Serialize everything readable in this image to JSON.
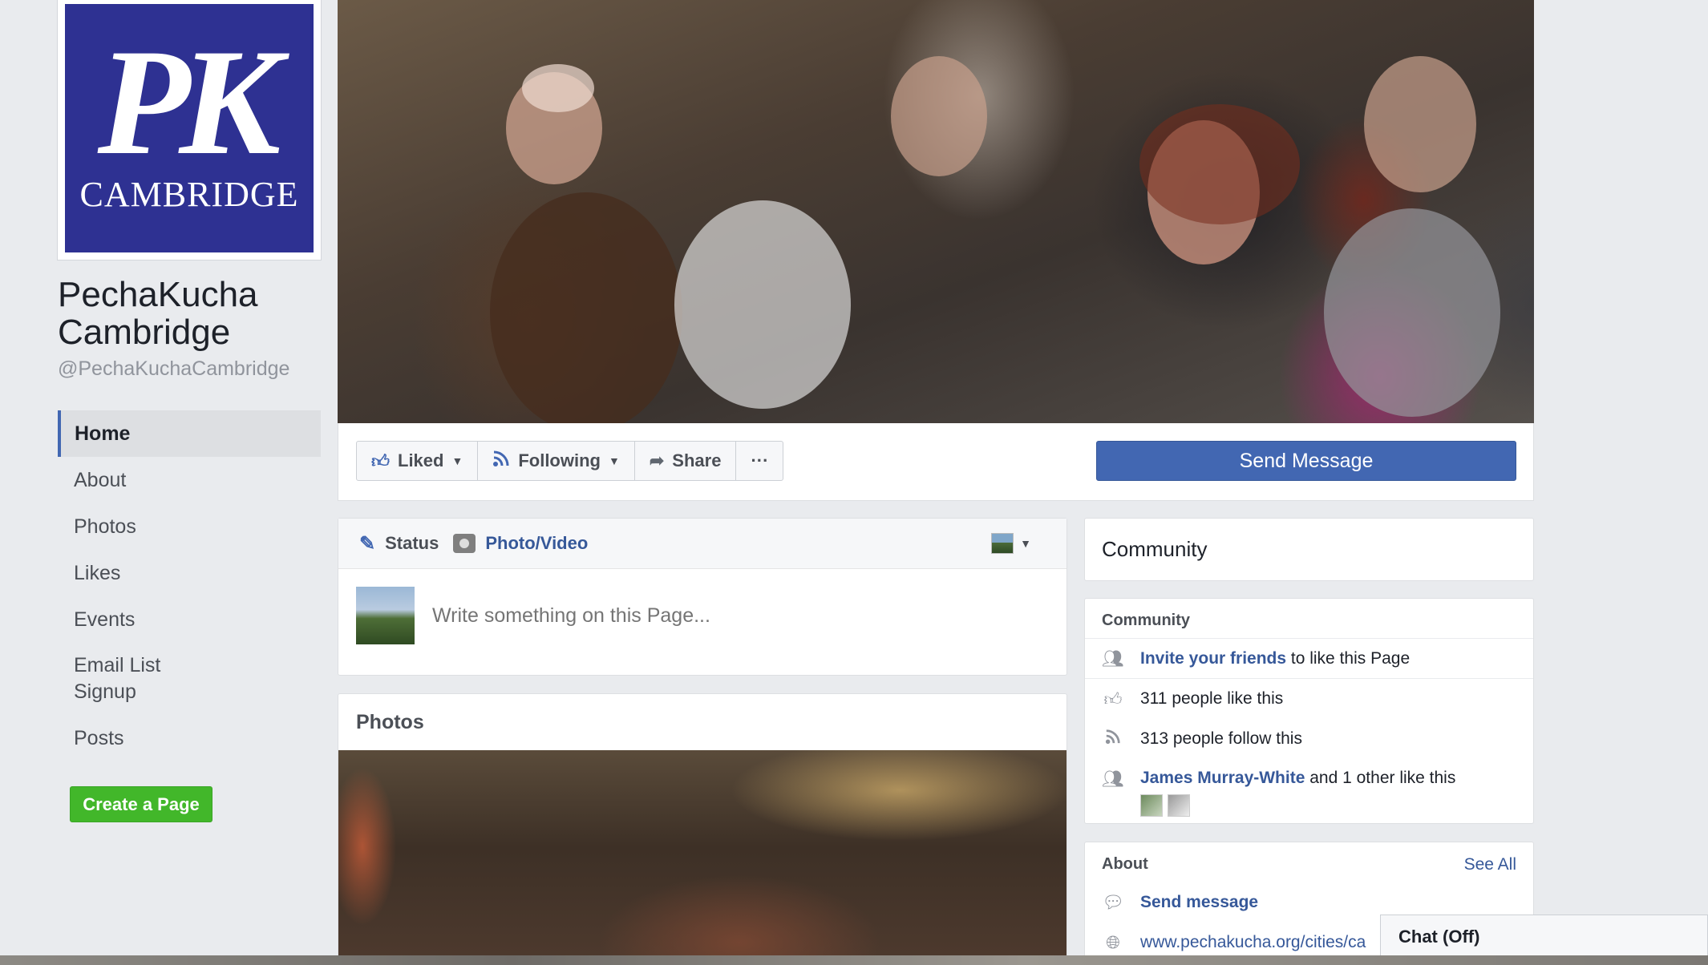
{
  "page": {
    "logo": {
      "monogram": "PK",
      "city": "CAMBRIDGE",
      "bg_color": "#2e3192"
    },
    "name": "PechaKucha Cambridge",
    "handle": "@PechaKuchaCambridge"
  },
  "nav": {
    "items": [
      {
        "label": "Home",
        "active": true
      },
      {
        "label": "About"
      },
      {
        "label": "Photos"
      },
      {
        "label": "Likes"
      },
      {
        "label": "Events"
      },
      {
        "label": "Email List Signup"
      },
      {
        "label": "Posts"
      }
    ],
    "create_page": "Create a Page"
  },
  "actions": {
    "liked": "Liked",
    "following": "Following",
    "share": "Share",
    "more": "···",
    "send_message": "Send Message"
  },
  "composer": {
    "tab_status": "Status",
    "tab_photo": "Photo/Video",
    "placeholder": "Write something on this Page..."
  },
  "photos": {
    "title": "Photos"
  },
  "community": {
    "header": "Community",
    "sub_title": "Community",
    "invite_link": "Invite your friends",
    "invite_rest": " to like this Page",
    "likes": "311 people like this",
    "follows": "313 people follow this",
    "friend_link": "James Murray-White",
    "friend_rest": " and 1 other like this"
  },
  "about": {
    "title": "About",
    "see_all": "See All",
    "send_message": "Send message",
    "website": "www.pechakucha.org/cities/ca"
  },
  "chat": {
    "label": "Chat (Off)"
  },
  "colors": {
    "accent": "#4267b2",
    "link": "#365899",
    "green": "#42b72a",
    "bg": "#e9ebee"
  }
}
